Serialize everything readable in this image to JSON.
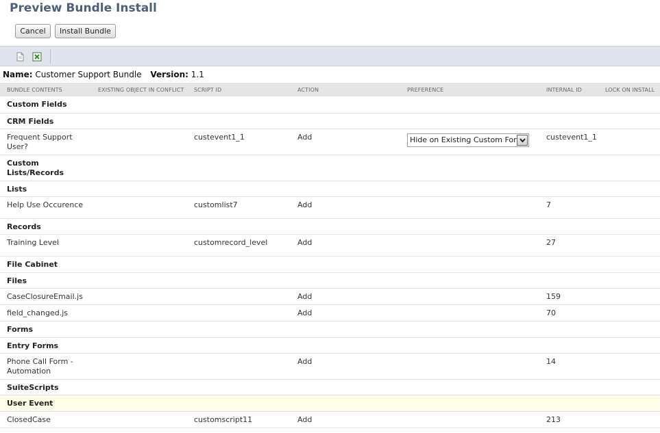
{
  "page": {
    "title": "Preview Bundle Install"
  },
  "buttons": {
    "cancel": "Cancel",
    "install": "Install Bundle"
  },
  "toolbar": {
    "print_icon": "print-icon",
    "excel_icon": "export-excel-icon"
  },
  "bundle": {
    "name_label": "Name:",
    "name": "Customer Support Bundle",
    "version_label": "Version:",
    "version": "1.1"
  },
  "table": {
    "columns": {
      "contents": "BUNDLE CONTENTS",
      "conflict": "EXISTING OBJECT IN CONFLICT",
      "script_id": "SCRIPT ID",
      "action": "ACTION",
      "preference": "PREFERENCE",
      "internal_id": "INTERNAL ID",
      "lock": "LOCK ON INSTALL"
    },
    "rows": [
      {
        "group": "Custom Fields"
      },
      {
        "group": "CRM Fields"
      },
      {
        "contents": "Frequent Support User?",
        "script_id": "custevent1_1",
        "action": "Add",
        "preference": "Hide on Existing Custom Forms",
        "internal_id": "custevent1_1"
      },
      {
        "group": "Custom Lists/Records"
      },
      {
        "group": "Lists"
      },
      {
        "contents": "Help Use Occurence",
        "script_id": "customlist7",
        "action": "Add",
        "internal_id": "7"
      },
      {
        "group": "Records"
      },
      {
        "contents": "Training Level",
        "script_id": "customrecord_level",
        "action": "Add",
        "internal_id": "27"
      },
      {
        "group": "File Cabinet"
      },
      {
        "group": "Files"
      },
      {
        "contents": "CaseClosureEmail.js",
        "action": "Add",
        "internal_id": "159"
      },
      {
        "contents": "field_changed.js",
        "action": "Add",
        "internal_id": "70"
      },
      {
        "group": "Forms"
      },
      {
        "group": "Entry Forms"
      },
      {
        "contents": "Phone Call Form - Automation",
        "action": "Add",
        "internal_id": "14"
      },
      {
        "group": "SuiteScripts"
      },
      {
        "group": "User Event"
      },
      {
        "contents": "ClosedCase",
        "script_id": "customscript11",
        "action": "Add",
        "internal_id": "213"
      }
    ]
  }
}
